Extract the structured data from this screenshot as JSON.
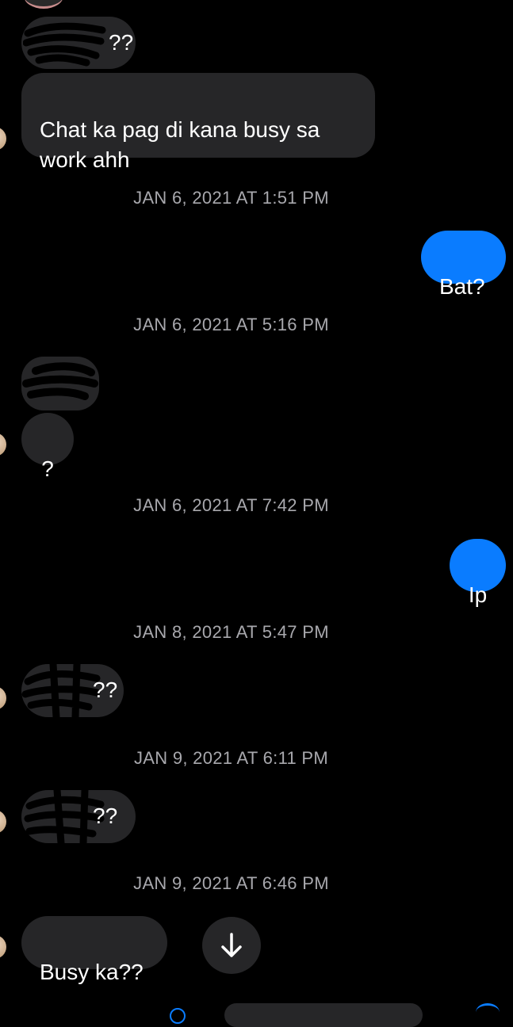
{
  "messages": [
    {
      "id": "m1",
      "direction": "incoming",
      "text": "??"
    },
    {
      "id": "m2",
      "direction": "incoming",
      "text": "Chat ka pag di kana busy sa\nwork ahh"
    },
    {
      "id": "t1",
      "timestamp": "JAN 6, 2021 AT 1:51 PM"
    },
    {
      "id": "m3",
      "direction": "outgoing",
      "text": "Bat?"
    },
    {
      "id": "t2",
      "timestamp": "JAN 6, 2021 AT 5:16 PM"
    },
    {
      "id": "m4",
      "direction": "incoming",
      "text": ""
    },
    {
      "id": "m5",
      "direction": "incoming",
      "text": "?"
    },
    {
      "id": "t3",
      "timestamp": "JAN 6, 2021 AT 7:42 PM"
    },
    {
      "id": "m6",
      "direction": "outgoing",
      "text": "Ip"
    },
    {
      "id": "t4",
      "timestamp": "JAN 8, 2021 AT 5:47 PM"
    },
    {
      "id": "m7",
      "direction": "incoming",
      "text": "??"
    },
    {
      "id": "t5",
      "timestamp": "JAN 9, 2021 AT 6:11 PM"
    },
    {
      "id": "m8",
      "direction": "incoming",
      "text": "??"
    },
    {
      "id": "t6",
      "timestamp": "JAN 9, 2021 AT 6:46 PM"
    },
    {
      "id": "m9",
      "direction": "incoming",
      "text": "Busy ka??"
    }
  ],
  "scroll_button": {
    "icon": "arrow-down-icon"
  },
  "colors": {
    "background": "#000000",
    "incoming_bubble": "#262628",
    "outgoing_bubble": "#0a7cff",
    "timestamp": "#a8a8ad"
  }
}
